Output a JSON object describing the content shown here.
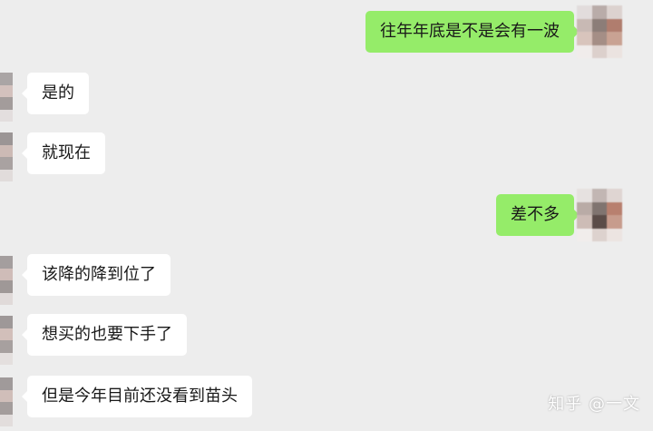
{
  "messages": [
    {
      "side": "right",
      "text": "往年年底是不是会有一波"
    },
    {
      "side": "left",
      "text": "是的"
    },
    {
      "side": "left",
      "text": "就现在"
    },
    {
      "side": "right",
      "text": "差不多"
    },
    {
      "side": "left",
      "text": "该降的降到位了"
    },
    {
      "side": "left",
      "text": "想买的也要下手了"
    },
    {
      "side": "left",
      "text": "但是今年目前还没看到苗头"
    }
  ],
  "watermark": "知乎 @一文",
  "colors": {
    "background": "#ededed",
    "outgoing_bubble": "#95ec69",
    "incoming_bubble": "#ffffff",
    "text": "#191919"
  }
}
